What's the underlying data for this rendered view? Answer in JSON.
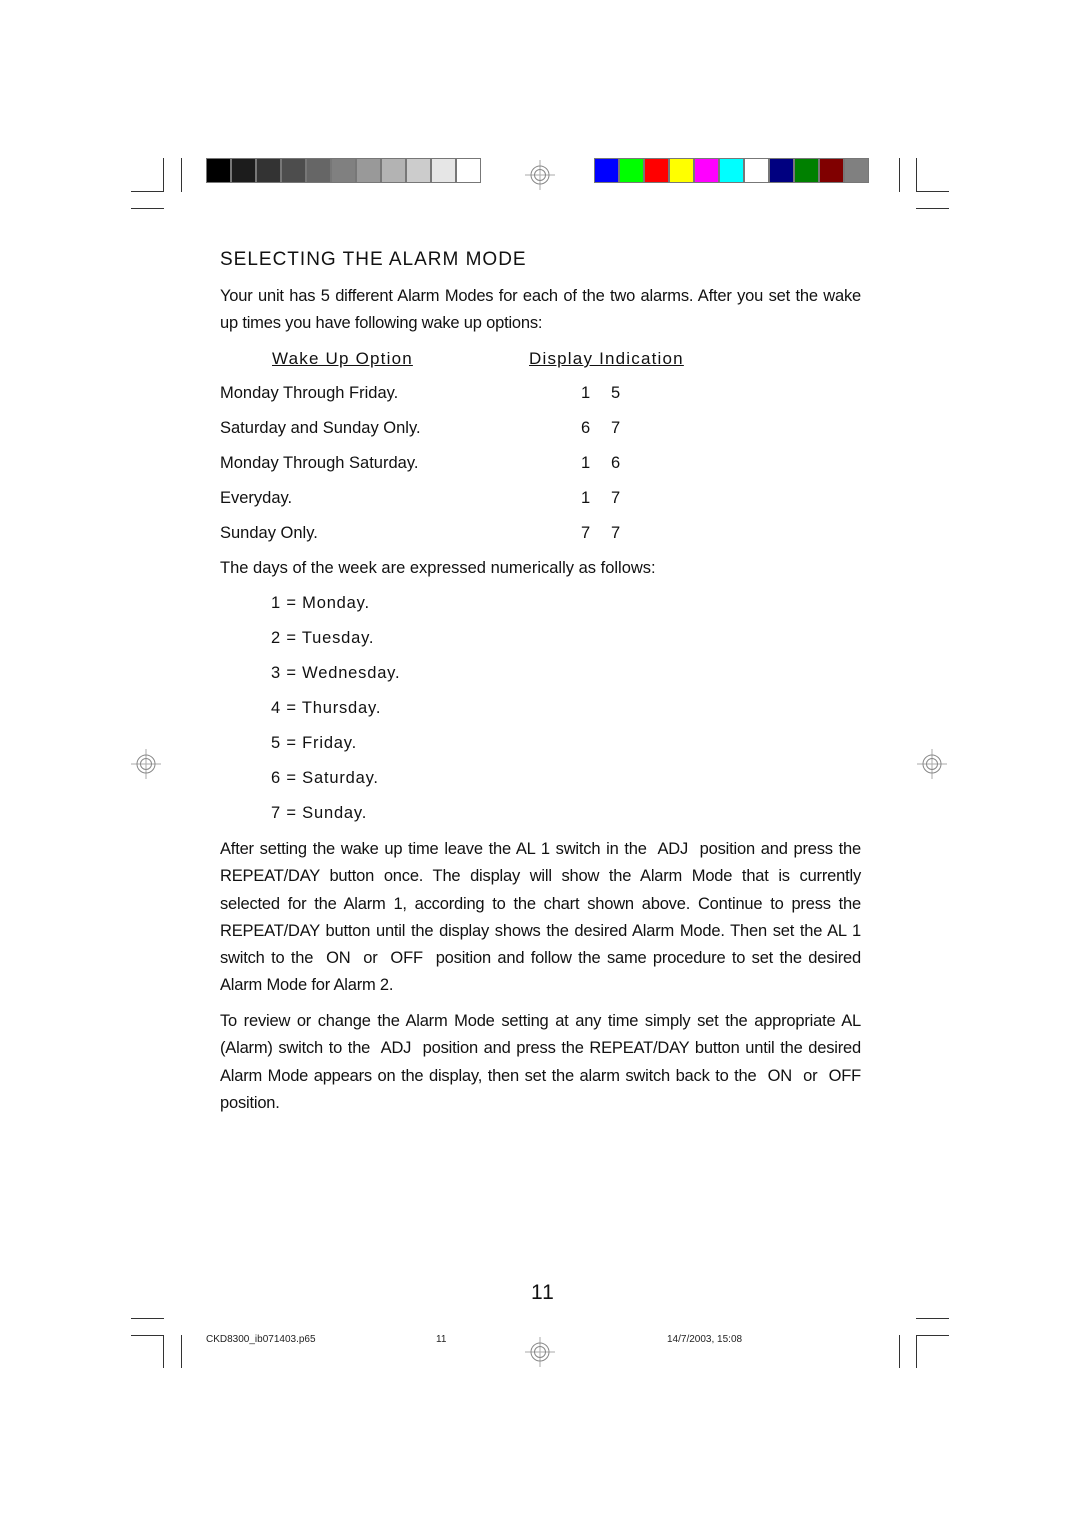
{
  "print_marks": {
    "grayscale_swatches": [
      "#000000",
      "#1c1c1c",
      "#333333",
      "#4d4d4d",
      "#666666",
      "#808080",
      "#999999",
      "#b3b3b3",
      "#cccccc",
      "#e6e6e6",
      "#ffffff"
    ],
    "color_swatches": [
      "#0000ff",
      "#00ff00",
      "#ff0000",
      "#ffff00",
      "#ff00ff",
      "#00ffff",
      "#ffffff",
      "#000080",
      "#008000",
      "#800000",
      "#808080"
    ]
  },
  "section": {
    "title": "SELECTING THE ALARM MODE",
    "intro": "Your unit has 5 different Alarm Modes for each of the two alarms. After you set the wake up times you have following wake up options:"
  },
  "modes_table": {
    "headers": [
      "Wake Up Option",
      "Display Indication"
    ],
    "rows": [
      {
        "option": "Monday Through Friday.",
        "start": "1",
        "end": "5"
      },
      {
        "option": "Saturday and Sunday Only.",
        "start": "6",
        "end": "7"
      },
      {
        "option": "Monday Through Saturday.",
        "start": "1",
        "end": "6"
      },
      {
        "option": "Everyday.",
        "start": "1",
        "end": "7"
      },
      {
        "option": "Sunday Only.",
        "start": "7",
        "end": "7"
      }
    ]
  },
  "days_intro": "The days of the week are expressed numerically as follows:",
  "days": [
    "1 = Monday.",
    "2 = Tuesday.",
    "3 = Wednesday.",
    "4 = Thursday.",
    "5 = Friday.",
    "6 = Saturday.",
    "7 = Sunday."
  ],
  "paragraphs": [
    "After setting the wake up time leave the AL 1 switch in the  ADJ  position and press the REPEAT/DAY button once. The display will show the Alarm Mode that is currently selected for the Alarm 1, according to the chart shown above. Continue to press the REPEAT/DAY button until the display shows the desired Alarm Mode. Then set the AL 1 switch to the  ON  or  OFF  position and follow the same procedure to set the desired Alarm Mode for Alarm 2.",
    "To review or change the Alarm Mode setting at any time simply set the appropriate AL (Alarm) switch to the  ADJ  position and press the REPEAT/DAY button until the desired Alarm Mode appears on the display, then set the alarm switch back to the  ON  or  OFF  position."
  ],
  "page_number": "11",
  "footer": {
    "filename": "CKD8300_ib071403.p65",
    "page": "11",
    "timestamp": "14/7/2003, 15:08"
  }
}
